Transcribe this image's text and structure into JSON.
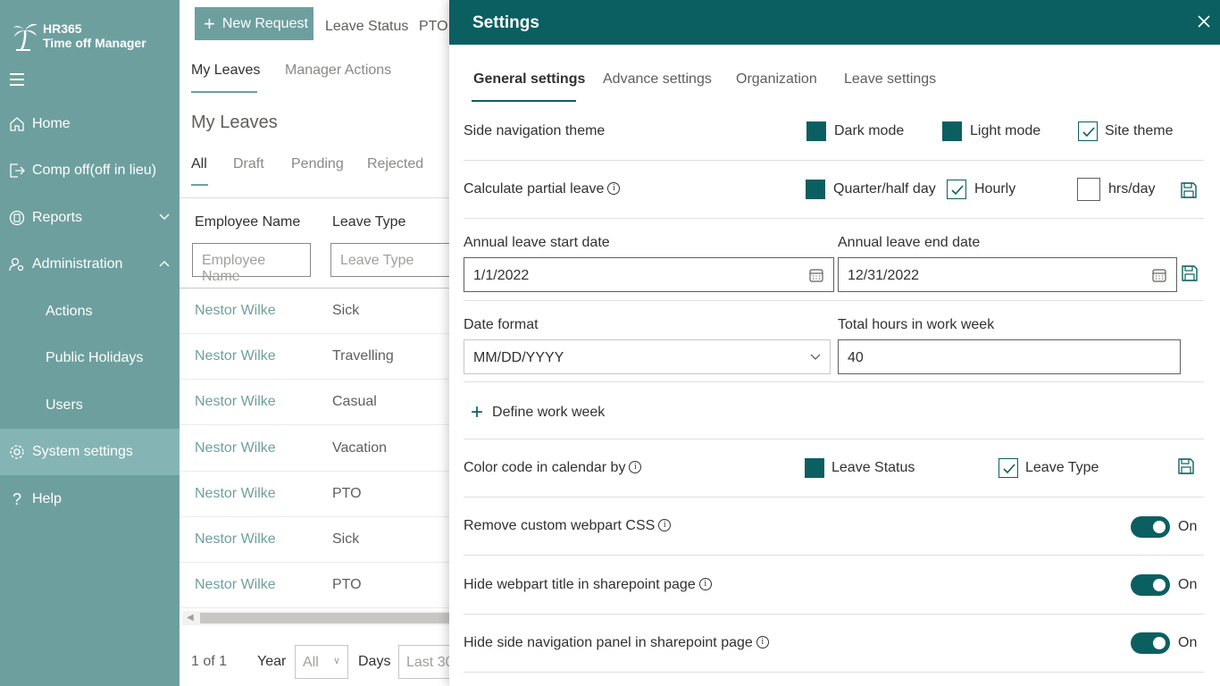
{
  "sidebar": {
    "logo_line1": "HR365",
    "logo_line2": "Time off Manager",
    "items": [
      {
        "label": "Home"
      },
      {
        "label": "Comp off(off in lieu)"
      },
      {
        "label": "Reports"
      },
      {
        "label": "Administration"
      },
      {
        "label": "Actions"
      },
      {
        "label": "Public Holidays"
      },
      {
        "label": "Users"
      },
      {
        "label": "System settings"
      },
      {
        "label": "Help"
      }
    ]
  },
  "main": {
    "new_request": "New Request",
    "leave_status": "Leave Status",
    "pto": "PTO:",
    "tabs": [
      "My Leaves",
      "Manager Actions"
    ],
    "title": "My Leaves",
    "filter_tabs": [
      "All",
      "Draft",
      "Pending",
      "Rejected"
    ],
    "columns": [
      "Employee Name",
      "Leave Type"
    ],
    "filter_placeholders": [
      "Employee Name",
      "Leave Type"
    ],
    "rows": [
      {
        "name": "Nestor Wilke",
        "type": "Sick"
      },
      {
        "name": "Nestor Wilke",
        "type": "Travelling"
      },
      {
        "name": "Nestor Wilke",
        "type": "Casual"
      },
      {
        "name": "Nestor Wilke",
        "type": "Vacation"
      },
      {
        "name": "Nestor Wilke",
        "type": "PTO"
      },
      {
        "name": "Nestor Wilke",
        "type": "Sick"
      },
      {
        "name": "Nestor Wilke",
        "type": "PTO"
      }
    ],
    "footer": {
      "page": "1 of 1",
      "year_label": "Year",
      "year_value": "All",
      "days_label": "Days",
      "days_value": "Last 30"
    }
  },
  "panel": {
    "title": "Settings",
    "tabs": [
      "General settings",
      "Advance settings",
      "Organization",
      "Leave settings"
    ],
    "side_nav": {
      "label": "Side navigation theme",
      "options": [
        "Dark mode",
        "Light mode",
        "Site theme"
      ]
    },
    "partial": {
      "label": "Calculate partial leave",
      "options": [
        "Quarter/half day",
        "Hourly",
        "hrs/day"
      ]
    },
    "annual_start": {
      "label": "Annual leave start date",
      "value": "1/1/2022"
    },
    "annual_end": {
      "label": "Annual leave end date",
      "value": "12/31/2022"
    },
    "date_format": {
      "label": "Date format",
      "value": "MM/DD/YYYY"
    },
    "work_week": {
      "label": "Total hours in work week",
      "value": "40"
    },
    "define_week": "Define work week",
    "color_code": {
      "label": "Color code in calendar by",
      "options": [
        "Leave Status",
        "Leave Type"
      ]
    },
    "toggles": [
      {
        "label": "Remove custom webpart CSS",
        "state": "On"
      },
      {
        "label": "Hide webpart title in sharepoint page",
        "state": "On"
      },
      {
        "label": "Hide side navigation panel in sharepoint page",
        "state": "On"
      }
    ]
  },
  "colors": {
    "accent": "#0b5f61",
    "sidebar": "#6e9f9f"
  }
}
